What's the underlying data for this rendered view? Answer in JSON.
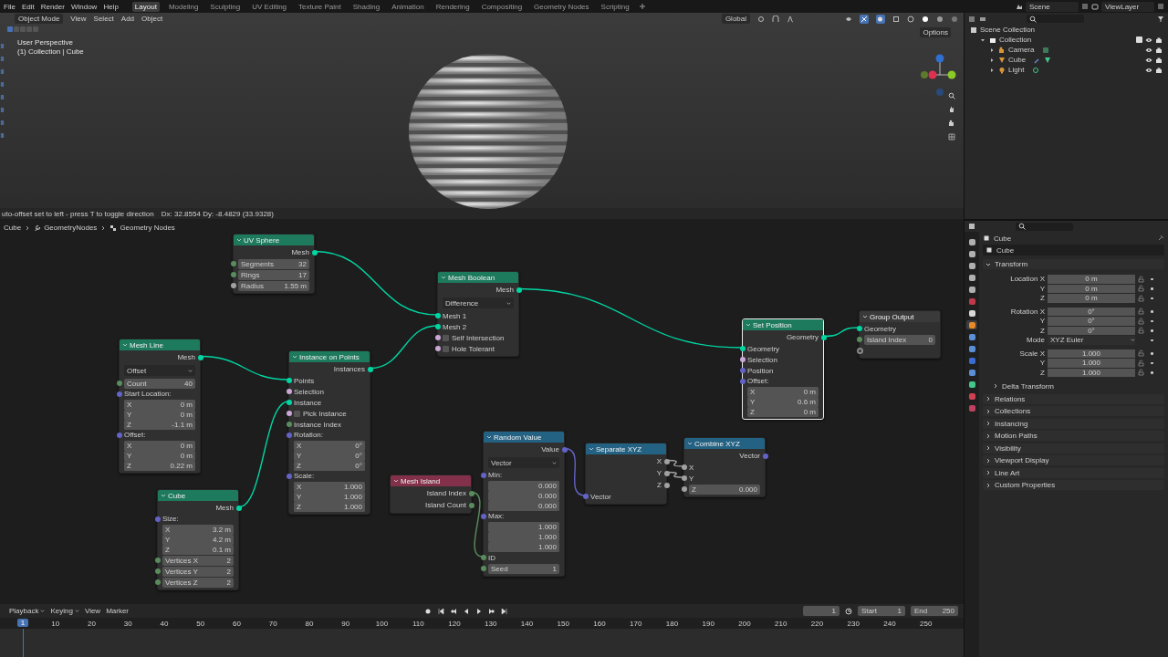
{
  "top_bar": {
    "menus": [
      "File",
      "Edit",
      "Render",
      "Window",
      "Help"
    ],
    "workspaces": [
      {
        "label": "Layout",
        "selected": true
      },
      {
        "label": "Modeling",
        "selected": false
      },
      {
        "label": "Sculpting",
        "selected": false
      },
      {
        "label": "UV Editing",
        "selected": false
      },
      {
        "label": "Texture Paint",
        "selected": false
      },
      {
        "label": "Shading",
        "selected": false
      },
      {
        "label": "Animation",
        "selected": false
      },
      {
        "label": "Rendering",
        "selected": false
      },
      {
        "label": "Compositing",
        "selected": false
      },
      {
        "label": "Geometry Nodes",
        "selected": false
      },
      {
        "label": "Scripting",
        "selected": false
      }
    ],
    "scene": "Scene",
    "view_layer": "ViewLayer"
  },
  "viewport": {
    "mode": "Object Mode",
    "menus": [
      "View",
      "Select",
      "Add",
      "Object"
    ],
    "orientation": "Global",
    "options": "Options",
    "view_name": "User Perspective",
    "context": "(1) Collection | Cube",
    "select_modes": [
      {
        "selected": true
      },
      {
        "selected": false
      },
      {
        "selected": false
      },
      {
        "selected": false
      },
      {
        "selected": false
      }
    ]
  },
  "node_editor": {
    "status": "uto-offset set to left - press T to toggle direction",
    "delta": "Dx: 32.8554   Dy: -8.4829 (33.9328)",
    "breadcrumbs": [
      "Cube",
      "GeometryNodes",
      "Geometry Nodes"
    ],
    "nodes": [
      {
        "title": "UV Sphere",
        "color": "#1d7a5d",
        "selected": false,
        "rows": [
          {
            "kind": "output",
            "label": "Mesh",
            "color": "#00d6a3"
          },
          {
            "kind": "field",
            "label": "Segments",
            "value": "32",
            "color": "#598c5c"
          },
          {
            "kind": "field",
            "label": "Rings",
            "value": "17",
            "color": "#598c5c"
          },
          {
            "kind": "field",
            "label": "Radius",
            "value": "1.55 m",
            "color": "#a1a1a1"
          }
        ]
      },
      {
        "title": "Mesh Boolean",
        "color": "#1d7a5d",
        "selected": false,
        "rows": [
          {
            "kind": "output",
            "label": "Mesh",
            "color": "#00d6a3"
          },
          {
            "kind": "dropdown",
            "value": "Difference"
          },
          {
            "kind": "input",
            "label": "Mesh 1",
            "color": "#00d6a3"
          },
          {
            "kind": "input",
            "label": "Mesh 2",
            "color": "#00d6a3"
          },
          {
            "kind": "check",
            "label": "Self Intersection",
            "checked": false,
            "color": "#cca6d6"
          },
          {
            "kind": "check",
            "label": "Hole Tolerant",
            "checked": false,
            "color": "#cca6d6"
          }
        ]
      },
      {
        "title": "Mesh Line",
        "color": "#1d7a5d",
        "selected": false,
        "rows": [
          {
            "kind": "output",
            "label": "Mesh",
            "color": "#00d6a3"
          },
          {
            "kind": "dropdown",
            "value": "Offset"
          },
          {
            "kind": "field",
            "label": "Count",
            "value": "40",
            "color": "#598c5c"
          },
          {
            "kind": "vector",
            "label": "Start Location:",
            "color": "#6363c7",
            "items": [
              {
                "axis": "X",
                "value": "0 m"
              },
              {
                "axis": "Y",
                "value": "0 m"
              },
              {
                "axis": "Z",
                "value": "-1.1 m"
              }
            ]
          },
          {
            "kind": "vector",
            "label": "Offset:",
            "color": "#6363c7",
            "items": [
              {
                "axis": "X",
                "value": "0 m"
              },
              {
                "axis": "Y",
                "value": "0 m"
              },
              {
                "axis": "Z",
                "value": "0.22 m"
              }
            ]
          }
        ]
      },
      {
        "title": "Instance on Points",
        "color": "#1d7a5d",
        "selected": false,
        "rows": [
          {
            "kind": "output",
            "label": "Instances",
            "color": "#00d6a3"
          },
          {
            "kind": "input",
            "label": "Points",
            "color": "#00d6a3"
          },
          {
            "kind": "input",
            "label": "Selection",
            "color": "#cca6d6"
          },
          {
            "kind": "input",
            "label": "Instance",
            "color": "#00d6a3"
          },
          {
            "kind": "check",
            "label": "Pick Instance",
            "checked": false,
            "color": "#cca6d6"
          },
          {
            "kind": "input",
            "label": "Instance Index",
            "color": "#598c5c"
          },
          {
            "kind": "vector",
            "label": "Rotation:",
            "color": "#6363c7",
            "items": [
              {
                "axis": "X",
                "value": "0°"
              },
              {
                "axis": "Y",
                "value": "0°"
              },
              {
                "axis": "Z",
                "value": "0°"
              }
            ]
          },
          {
            "kind": "vector",
            "label": "Scale:",
            "color": "#6363c7",
            "items": [
              {
                "axis": "X",
                "value": "1.000"
              },
              {
                "axis": "Y",
                "value": "1.000"
              },
              {
                "axis": "Z",
                "value": "1.000"
              }
            ]
          }
        ]
      },
      {
        "title": "Cube",
        "color": "#1d7a5d",
        "selected": false,
        "rows": [
          {
            "kind": "output",
            "label": "Mesh",
            "color": "#00d6a3"
          },
          {
            "kind": "vector",
            "label": "Size:",
            "color": "#6363c7",
            "items": [
              {
                "axis": "X",
                "value": "3.2 m"
              },
              {
                "axis": "Y",
                "value": "4.2 m"
              },
              {
                "axis": "Z",
                "value": "0.1 m"
              }
            ]
          },
          {
            "kind": "field",
            "label": "Vertices X",
            "value": "2",
            "color": "#598c5c"
          },
          {
            "kind": "field",
            "label": "Vertices Y",
            "value": "2",
            "color": "#598c5c"
          },
          {
            "kind": "field",
            "label": "Vertices Z",
            "value": "2",
            "color": "#598c5c"
          }
        ]
      },
      {
        "title": "Mesh Island",
        "color": "#83314a",
        "selected": false,
        "rows": [
          {
            "kind": "output",
            "label": "Island Index",
            "color": "#598c5c"
          },
          {
            "kind": "output",
            "label": "Island Count",
            "color": "#598c5c"
          }
        ]
      },
      {
        "title": "Random Value",
        "color": "#246283",
        "selected": false,
        "rows": [
          {
            "kind": "output",
            "label": "Value",
            "color": "#6363c7"
          },
          {
            "kind": "dropdown",
            "value": "Vector"
          },
          {
            "kind": "vector",
            "label": "Min:",
            "color": "#6363c7",
            "items": [
              {
                "value": "0.000"
              },
              {
                "value": "0.000"
              },
              {
                "value": "0.000"
              }
            ]
          },
          {
            "kind": "vector",
            "label": "Max:",
            "color": "#6363c7",
            "items": [
              {
                "value": "1.000"
              },
              {
                "value": "1.000"
              },
              {
                "value": "1.000"
              }
            ]
          },
          {
            "kind": "input",
            "label": "ID",
            "color": "#598c5c"
          },
          {
            "kind": "field",
            "label": "Seed",
            "value": "1",
            "color": "#598c5c"
          }
        ]
      },
      {
        "title": "Separate XYZ",
        "color": "#246283",
        "selected": false,
        "rows": [
          {
            "kind": "output",
            "label": "X",
            "color": "#a1a1a1"
          },
          {
            "kind": "output",
            "label": "Y",
            "color": "#a1a1a1"
          },
          {
            "kind": "output",
            "label": "Z",
            "color": "#a1a1a1"
          },
          {
            "kind": "input",
            "label": "Vector",
            "color": "#6363c7"
          }
        ]
      },
      {
        "title": "Combine XYZ",
        "color": "#246283",
        "selected": false,
        "rows": [
          {
            "kind": "output",
            "label": "Vector",
            "color": "#6363c7"
          },
          {
            "kind": "input",
            "label": "X",
            "color": "#a1a1a1"
          },
          {
            "kind": "input",
            "label": "Y",
            "color": "#a1a1a1"
          },
          {
            "kind": "field",
            "label": "Z",
            "value": "0.000",
            "color": "#a1a1a1"
          }
        ]
      },
      {
        "title": "Set Position",
        "color": "#1d7a5d",
        "selected": true,
        "rows": [
          {
            "kind": "output",
            "label": "Geometry",
            "color": "#00d6a3"
          },
          {
            "kind": "input",
            "label": "Geometry",
            "color": "#00d6a3"
          },
          {
            "kind": "input",
            "label": "Selection",
            "color": "#cca6d6"
          },
          {
            "kind": "input",
            "label": "Position",
            "color": "#6363c7"
          },
          {
            "kind": "vector",
            "label": "Offset:",
            "color": "#6363c7",
            "items": [
              {
                "axis": "X",
                "value": "0 m"
              },
              {
                "axis": "Y",
                "value": "0.6 m"
              },
              {
                "axis": "Z",
                "value": "0 m"
              }
            ]
          }
        ]
      },
      {
        "title": "Group Output",
        "color": "#3a3a3a",
        "selected": false,
        "rows": [
          {
            "kind": "input",
            "label": "Geometry",
            "color": "#00d6a3"
          },
          {
            "kind": "field",
            "label": "Island Index",
            "value": "0",
            "color": "#598c5c"
          },
          {
            "kind": "socket",
            "color": "#888888"
          }
        ]
      }
    ]
  },
  "timeline": {
    "menus": [
      "Playback",
      "Keying",
      "View",
      "Marker"
    ],
    "current_frame": "1",
    "start_label": "Start",
    "start": "1",
    "end_label": "End",
    "end": "250",
    "playhead": "1",
    "ruler": [
      "10",
      "20",
      "30",
      "40",
      "50",
      "60",
      "70",
      "80",
      "90",
      "100",
      "110",
      "120",
      "130",
      "140",
      "150",
      "160",
      "170",
      "180",
      "190",
      "200",
      "210",
      "220",
      "230",
      "240",
      "250"
    ]
  },
  "outliner": {
    "items": [
      {
        "label": "Scene Collection",
        "kind": "scene",
        "children": [
          {
            "label": "Collection",
            "kind": "collection",
            "checked": true,
            "expanded": true,
            "children": [
              {
                "label": "Camera",
                "kind": "camera",
                "expanded": false
              },
              {
                "label": "Cube",
                "kind": "mesh",
                "expanded": false
              },
              {
                "label": "Light",
                "kind": "light",
                "expanded": false
              }
            ]
          }
        ]
      }
    ]
  },
  "properties": {
    "object": "Cube",
    "name": "Cube",
    "tabs": [
      {
        "color": "#b0b0b0",
        "selected": false
      },
      {
        "color": "#b0b0b0",
        "selected": false
      },
      {
        "color": "#b0b0b0",
        "selected": false
      },
      {
        "color": "#b0b0b0",
        "selected": false
      },
      {
        "color": "#b0b0b0",
        "selected": false
      },
      {
        "color": "#c0394a",
        "selected": false
      },
      {
        "color": "#d8d8d8",
        "selected": false
      },
      {
        "color": "#e8892a",
        "selected": true
      },
      {
        "color": "#5a8fd8",
        "selected": false
      },
      {
        "color": "#5a8fd8",
        "selected": false
      },
      {
        "color": "#3a6bd0",
        "selected": false
      },
      {
        "color": "#5a8fd8",
        "selected": false
      },
      {
        "color": "#41c78a",
        "selected": false
      },
      {
        "color": "#d04050",
        "selected": false
      },
      {
        "color": "#c04060",
        "selected": false
      }
    ],
    "sections": [
      {
        "label": "Transform",
        "expanded": true,
        "groups": [
          {
            "rows": [
              {
                "kind": "number",
                "label": "Location X",
                "value": "0 m"
              },
              {
                "kind": "number",
                "label": "Y",
                "value": "0 m"
              },
              {
                "kind": "number",
                "label": "Z",
                "value": "0 m"
              }
            ]
          },
          {
            "rows": [
              {
                "kind": "number",
                "label": "Rotation X",
                "value": "0°"
              },
              {
                "kind": "number",
                "label": "Y",
                "value": "0°"
              },
              {
                "kind": "number",
                "label": "Z",
                "value": "0°"
              },
              {
                "kind": "dropdown",
                "label": "Mode",
                "value": "XYZ Euler"
              }
            ]
          },
          {
            "rows": [
              {
                "kind": "number",
                "label": "Scale X",
                "value": "1.000"
              },
              {
                "kind": "number",
                "label": "Y",
                "value": "1.000"
              },
              {
                "kind": "number",
                "label": "Z",
                "value": "1.000"
              }
            ]
          }
        ],
        "subsections": [
          {
            "label": "Delta Transform",
            "expanded": false
          }
        ]
      },
      {
        "label": "Relations",
        "expanded": false
      },
      {
        "label": "Collections",
        "expanded": false
      },
      {
        "label": "Instancing",
        "expanded": false
      },
      {
        "label": "Motion Paths",
        "expanded": false
      },
      {
        "label": "Visibility",
        "expanded": false
      },
      {
        "label": "Viewport Display",
        "expanded": false
      },
      {
        "label": "Line Art",
        "expanded": false
      },
      {
        "label": "Custom Properties",
        "expanded": false
      }
    ]
  }
}
